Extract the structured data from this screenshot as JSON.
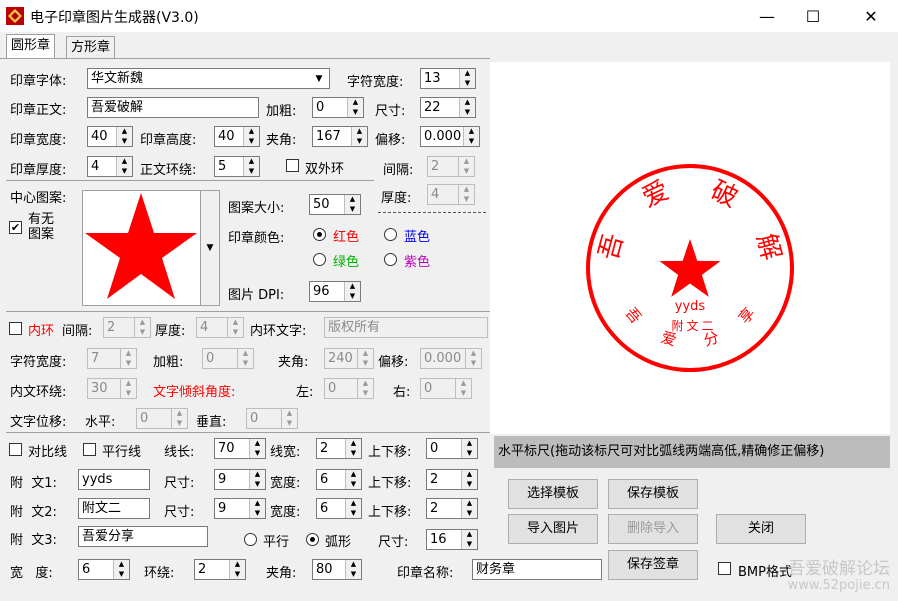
{
  "window": {
    "title": "电子印章图片生成器(V3.0)",
    "min": "—",
    "max": "☐",
    "close": "✕"
  },
  "tabs": [
    "圆形章",
    "方形章"
  ],
  "form": {
    "font_label": "印章字体:",
    "font_value": "华文新魏",
    "char_width_label": "字符宽度:",
    "char_width": "13",
    "text_label": "印章正文:",
    "text_value": "吾爱破解",
    "bold_label": "加粗:",
    "bold": "0",
    "size_label": "尺寸:",
    "size": "22",
    "width_label": "印章宽度:",
    "width": "40",
    "height_label": "印章高度:",
    "height": "40",
    "angle_label": "夹角:",
    "angle": "167",
    "offset_label": "偏移:",
    "offset": "0.000",
    "thickness_label": "印章厚度:",
    "thickness": "4",
    "ring_label": "正文环绕:",
    "ring": "5",
    "double_ring_label": "双外环",
    "gap_label": "间隔:",
    "gap": "2",
    "thick2_label": "厚度:",
    "thick2": "4"
  },
  "pattern": {
    "center_label": "中心图案:",
    "has_pattern_label": "有无图案",
    "has_pattern_check": "✔",
    "size_label": "图案大小:",
    "size": "50",
    "color_label": "印章颜色:",
    "colors": [
      {
        "name": "红色",
        "color": "#ff0000",
        "checked": true
      },
      {
        "name": "蓝色",
        "color": "#0000ff",
        "checked": false
      },
      {
        "name": "绿色",
        "color": "#00b000",
        "checked": false
      },
      {
        "name": "紫色",
        "color": "#c000c0",
        "checked": false
      }
    ],
    "dpi_label": "图片 DPI:",
    "dpi": "96",
    "dropdown": "▼"
  },
  "inner": {
    "ring_label": "内环",
    "gap_label": "间隔:",
    "gap": "2",
    "thick_label": "厚度:",
    "thick": "4",
    "text_label": "内环文字:",
    "text": "版权所有",
    "char_width_label": "字符宽度:",
    "char_width": "7",
    "bold_label": "加粗:",
    "bold": "0",
    "angle_label": "夹角:",
    "angle": "240",
    "offset_label": "偏移:",
    "offset": "0.000",
    "wrap_label": "内文环绕:",
    "wrap": "30",
    "tilt_label": "文字倾斜角度:",
    "left_label": "左:",
    "left": "0",
    "right_label": "右:",
    "right": "0",
    "shift_label": "文字位移:",
    "h_label": "水平:",
    "h": "0",
    "v_label": "垂直:",
    "v": "0"
  },
  "lines": {
    "contrast_label": "对比线",
    "parallel_label": "平行线",
    "len_label": "线长:",
    "len": "70",
    "lw_label": "线宽:",
    "lw": "2",
    "shift_label": "上下移:",
    "shift": "0"
  },
  "extra": [
    {
      "label": "附  文1:",
      "value": "yyds",
      "size_label": "尺寸:",
      "size": "9",
      "w_label": "宽度:",
      "w": "6",
      "shift_label": "上下移:",
      "shift": "2"
    },
    {
      "label": "附  文2:",
      "value": "附文二",
      "size_label": "尺寸:",
      "size": "9",
      "w_label": "宽度:",
      "w": "6",
      "shift_label": "上下移:",
      "shift": "2"
    }
  ],
  "extra3": {
    "label": "附  文3:",
    "value": "吾爱分享",
    "parallel": "平行",
    "arc": "弧形",
    "size_label": "尺寸:",
    "size": "16"
  },
  "bottom": {
    "width_label": "宽   度:",
    "width": "6",
    "wrap_label": "环绕:",
    "wrap": "2",
    "angle_label": "夹角:",
    "angle": "80",
    "name_label": "印章名称:",
    "name": "财务章",
    "bmp_label": "BMP格式"
  },
  "buttons": {
    "select_tpl": "选择模板",
    "save_tpl": "保存模板",
    "import_img": "导入图片",
    "delete_import": "删除导入",
    "close": "关闭",
    "save_sign": "保存签章"
  },
  "status": "水平标尺(拖动该标尺可对比弧线两端高低,精确修正偏移)",
  "seal": {
    "color": "#ff0000",
    "top_chars": [
      "吾",
      "爱",
      "破",
      "解"
    ],
    "bottom_chars": [
      "吾",
      "爱",
      "分",
      "享"
    ],
    "inner_text": "附文二",
    "mid_text": "yyds"
  },
  "watermark": {
    "line1": "吾爱破解论坛",
    "line2": "www.52pojie.cn"
  },
  "spin_up": "▲",
  "spin_down": "▼"
}
